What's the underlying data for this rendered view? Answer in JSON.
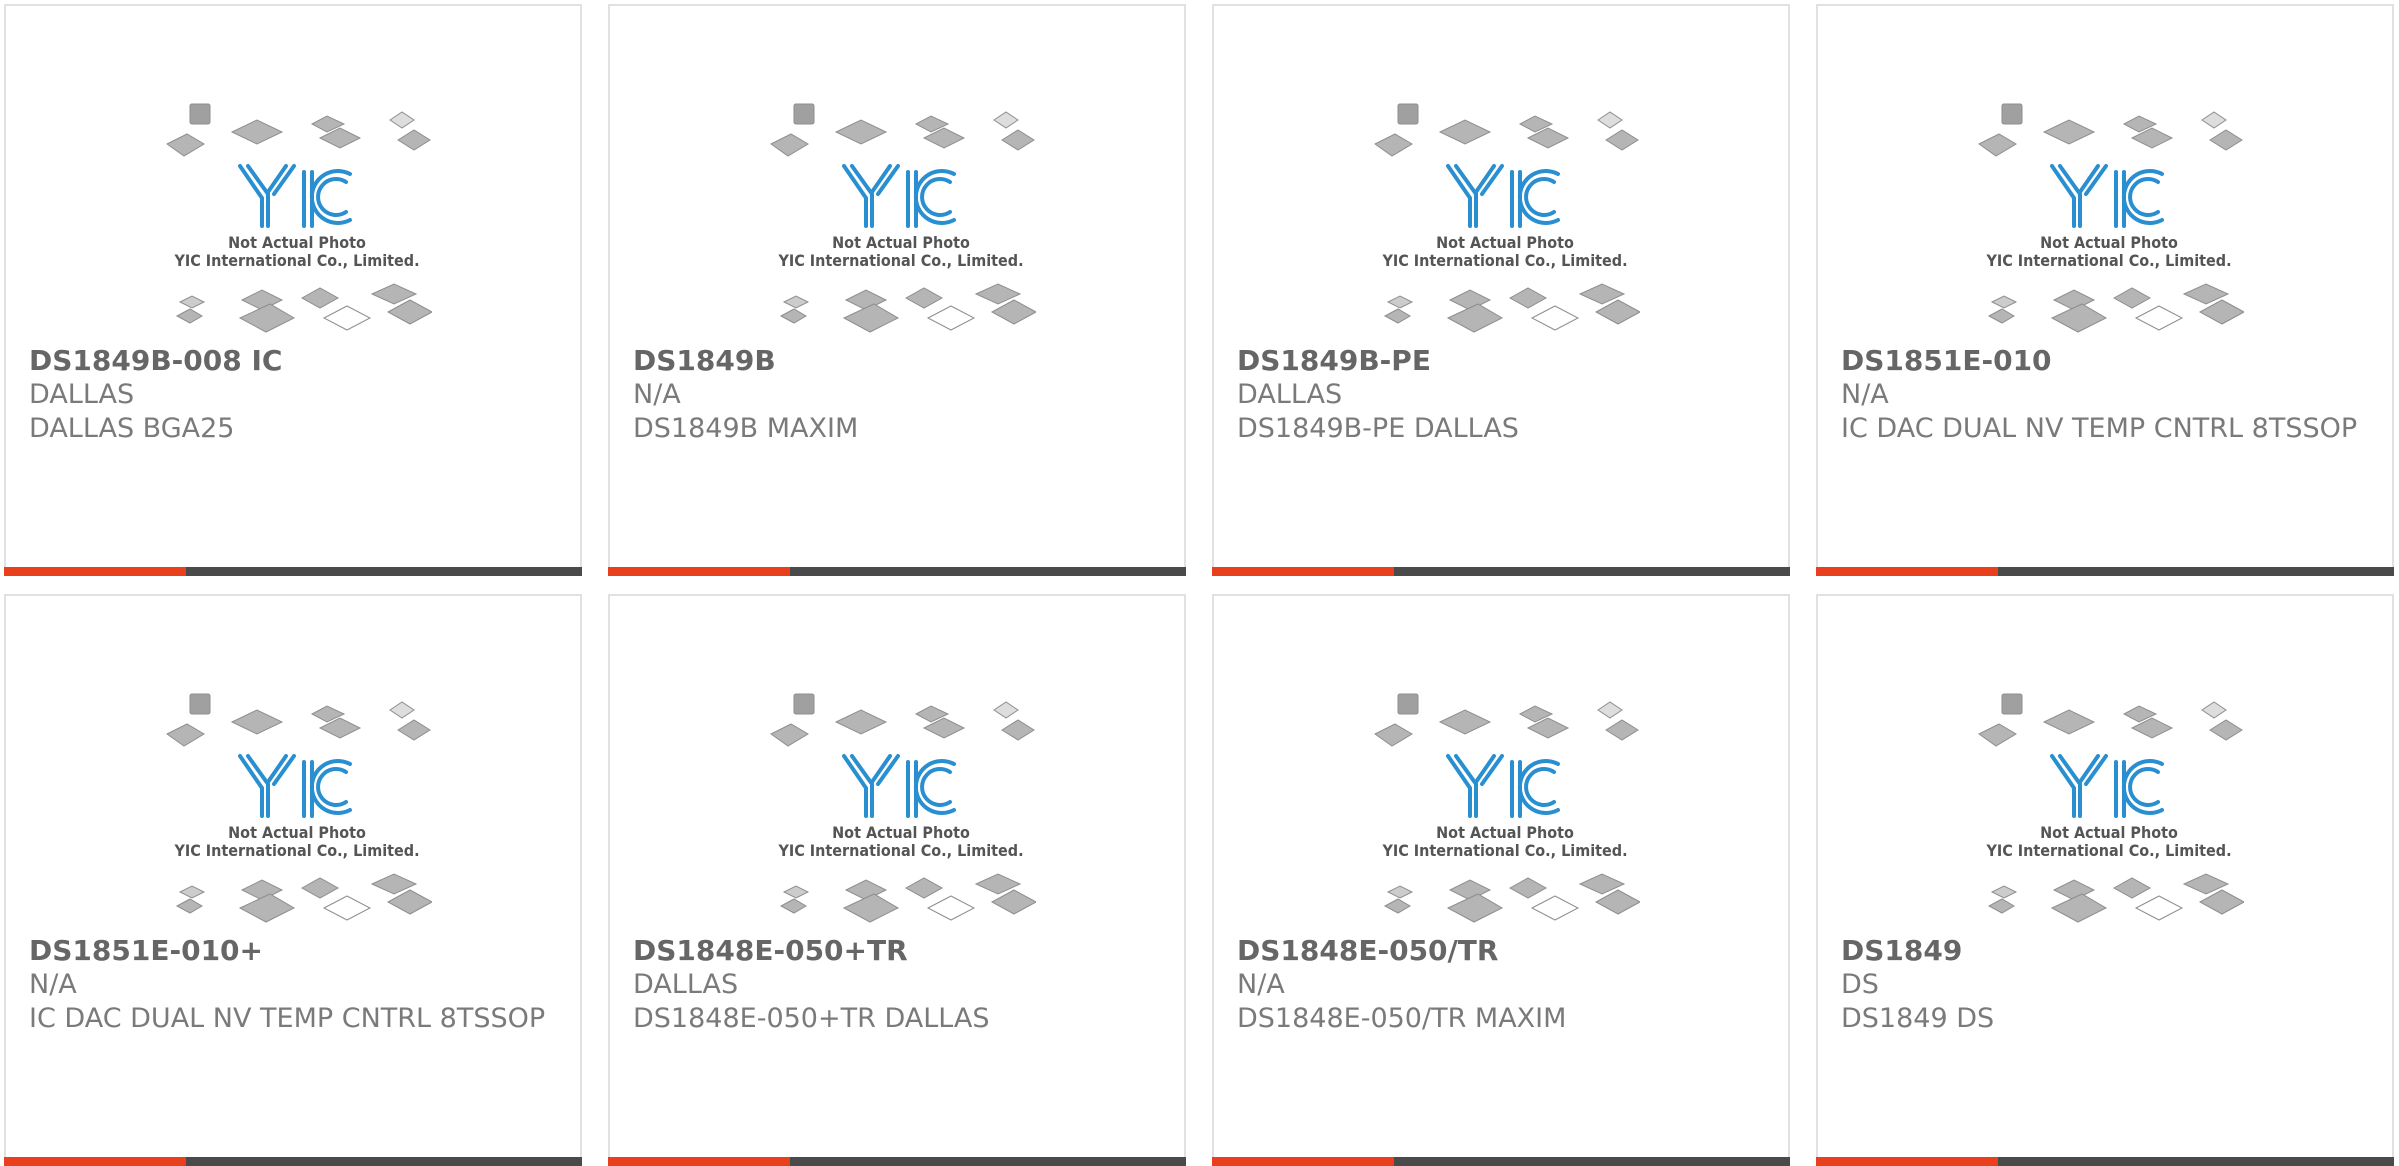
{
  "theme": {
    "accent": "#e8401c",
    "bar": "#4a4a4a",
    "logo": "#2a8fd0"
  },
  "placeholder": {
    "logo_text": "YIC",
    "caption_line1": "Not Actual Photo",
    "caption_line2": "YIC International Co., Limited."
  },
  "products": [
    {
      "part": "DS1849B-008 IC",
      "mfr": "DALLAS",
      "desc": "DALLAS BGA25"
    },
    {
      "part": "DS1849B",
      "mfr": "N/A",
      "desc": "DS1849B MAXIM"
    },
    {
      "part": "DS1849B-PE",
      "mfr": "DALLAS",
      "desc": "DS1849B-PE DALLAS"
    },
    {
      "part": "DS1851E-010",
      "mfr": "N/A",
      "desc": "IC DAC DUAL NV TEMP CNTRL 8TSSOP"
    },
    {
      "part": "DS1851E-010+",
      "mfr": "N/A",
      "desc": "IC DAC DUAL NV TEMP CNTRL 8TSSOP"
    },
    {
      "part": "DS1848E-050+TR",
      "mfr": "DALLAS",
      "desc": "DS1848E-050+TR DALLAS"
    },
    {
      "part": "DS1848E-050/TR",
      "mfr": "N/A",
      "desc": "DS1848E-050/TR MAXIM"
    },
    {
      "part": "DS1849",
      "mfr": "DS",
      "desc": "DS1849 DS"
    }
  ]
}
